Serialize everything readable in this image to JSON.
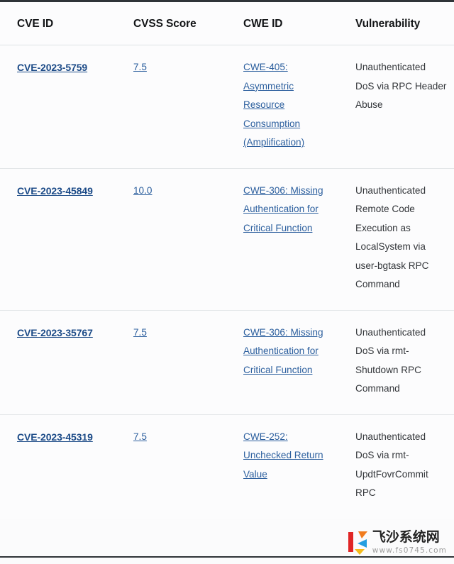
{
  "table": {
    "columns": [
      {
        "key": "cve",
        "label": "CVE ID"
      },
      {
        "key": "cvss",
        "label": "CVSS Score"
      },
      {
        "key": "cwe",
        "label": "CWE ID"
      },
      {
        "key": "vuln",
        "label": "Vulnerability"
      }
    ],
    "rows": [
      {
        "cve": "CVE-2023-5759",
        "cvss": "7.5",
        "cwe": "CWE-405: Asymmetric Resource Consumption (Amplification)",
        "vuln": "Unauthenticated DoS via RPC Header Abuse"
      },
      {
        "cve": "CVE-2023-45849",
        "cvss": "10.0",
        "cwe": "CWE-306: Missing Authentication for Critical Function",
        "vuln": "Unauthenticated Remote Code Execution as LocalSystem via user-bgtask RPC Command"
      },
      {
        "cve": "CVE-2023-35767",
        "cvss": "7.5",
        "cwe": "CWE-306: Missing Authentication for Critical Function",
        "vuln": "Unauthenticated DoS via rmt-Shutdown RPC Command"
      },
      {
        "cve": "CVE-2023-45319",
        "cvss": "7.5",
        "cwe": "CWE-252: Unchecked Return Value",
        "vuln": "Unauthenticated DoS via rmt-UpdtFovrCommit RPC"
      }
    ]
  },
  "watermark": {
    "site_name": "飞沙系统网",
    "url": "www.fs0745.com",
    "logo_colors": {
      "red": "#e02020",
      "orange": "#f07818",
      "blue": "#1e9be0",
      "yellow": "#f5b913"
    }
  },
  "colors": {
    "link": "#1b4a87",
    "link_secondary": "#2c5f9e",
    "header_rule": "#2f3438",
    "row_rule": "#e3e6e8",
    "text": "#2a2d31",
    "background": "#fcfcfd"
  }
}
